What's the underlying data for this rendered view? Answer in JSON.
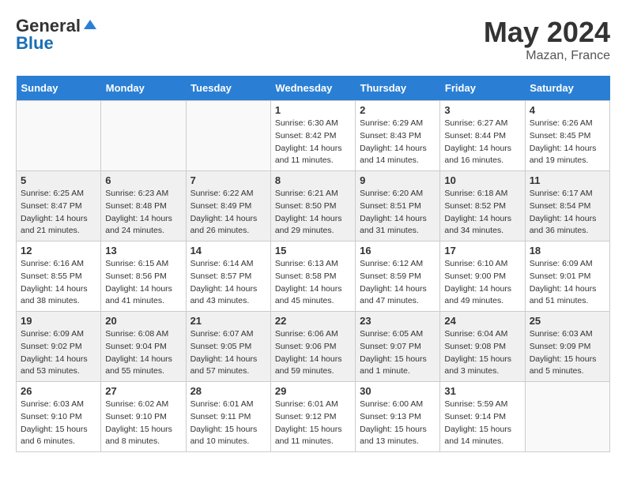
{
  "header": {
    "logo_general": "General",
    "logo_blue": "Blue",
    "title": "May 2024",
    "subtitle": "Mazan, France"
  },
  "days_of_week": [
    "Sunday",
    "Monday",
    "Tuesday",
    "Wednesday",
    "Thursday",
    "Friday",
    "Saturday"
  ],
  "weeks": [
    {
      "days": [
        {
          "number": "",
          "sunrise": "",
          "sunset": "",
          "daylight": ""
        },
        {
          "number": "",
          "sunrise": "",
          "sunset": "",
          "daylight": ""
        },
        {
          "number": "",
          "sunrise": "",
          "sunset": "",
          "daylight": ""
        },
        {
          "number": "1",
          "sunrise": "Sunrise: 6:30 AM",
          "sunset": "Sunset: 8:42 PM",
          "daylight": "Daylight: 14 hours and 11 minutes."
        },
        {
          "number": "2",
          "sunrise": "Sunrise: 6:29 AM",
          "sunset": "Sunset: 8:43 PM",
          "daylight": "Daylight: 14 hours and 14 minutes."
        },
        {
          "number": "3",
          "sunrise": "Sunrise: 6:27 AM",
          "sunset": "Sunset: 8:44 PM",
          "daylight": "Daylight: 14 hours and 16 minutes."
        },
        {
          "number": "4",
          "sunrise": "Sunrise: 6:26 AM",
          "sunset": "Sunset: 8:45 PM",
          "daylight": "Daylight: 14 hours and 19 minutes."
        }
      ]
    },
    {
      "days": [
        {
          "number": "5",
          "sunrise": "Sunrise: 6:25 AM",
          "sunset": "Sunset: 8:47 PM",
          "daylight": "Daylight: 14 hours and 21 minutes."
        },
        {
          "number": "6",
          "sunrise": "Sunrise: 6:23 AM",
          "sunset": "Sunset: 8:48 PM",
          "daylight": "Daylight: 14 hours and 24 minutes."
        },
        {
          "number": "7",
          "sunrise": "Sunrise: 6:22 AM",
          "sunset": "Sunset: 8:49 PM",
          "daylight": "Daylight: 14 hours and 26 minutes."
        },
        {
          "number": "8",
          "sunrise": "Sunrise: 6:21 AM",
          "sunset": "Sunset: 8:50 PM",
          "daylight": "Daylight: 14 hours and 29 minutes."
        },
        {
          "number": "9",
          "sunrise": "Sunrise: 6:20 AM",
          "sunset": "Sunset: 8:51 PM",
          "daylight": "Daylight: 14 hours and 31 minutes."
        },
        {
          "number": "10",
          "sunrise": "Sunrise: 6:18 AM",
          "sunset": "Sunset: 8:52 PM",
          "daylight": "Daylight: 14 hours and 34 minutes."
        },
        {
          "number": "11",
          "sunrise": "Sunrise: 6:17 AM",
          "sunset": "Sunset: 8:54 PM",
          "daylight": "Daylight: 14 hours and 36 minutes."
        }
      ]
    },
    {
      "days": [
        {
          "number": "12",
          "sunrise": "Sunrise: 6:16 AM",
          "sunset": "Sunset: 8:55 PM",
          "daylight": "Daylight: 14 hours and 38 minutes."
        },
        {
          "number": "13",
          "sunrise": "Sunrise: 6:15 AM",
          "sunset": "Sunset: 8:56 PM",
          "daylight": "Daylight: 14 hours and 41 minutes."
        },
        {
          "number": "14",
          "sunrise": "Sunrise: 6:14 AM",
          "sunset": "Sunset: 8:57 PM",
          "daylight": "Daylight: 14 hours and 43 minutes."
        },
        {
          "number": "15",
          "sunrise": "Sunrise: 6:13 AM",
          "sunset": "Sunset: 8:58 PM",
          "daylight": "Daylight: 14 hours and 45 minutes."
        },
        {
          "number": "16",
          "sunrise": "Sunrise: 6:12 AM",
          "sunset": "Sunset: 8:59 PM",
          "daylight": "Daylight: 14 hours and 47 minutes."
        },
        {
          "number": "17",
          "sunrise": "Sunrise: 6:10 AM",
          "sunset": "Sunset: 9:00 PM",
          "daylight": "Daylight: 14 hours and 49 minutes."
        },
        {
          "number": "18",
          "sunrise": "Sunrise: 6:09 AM",
          "sunset": "Sunset: 9:01 PM",
          "daylight": "Daylight: 14 hours and 51 minutes."
        }
      ]
    },
    {
      "days": [
        {
          "number": "19",
          "sunrise": "Sunrise: 6:09 AM",
          "sunset": "Sunset: 9:02 PM",
          "daylight": "Daylight: 14 hours and 53 minutes."
        },
        {
          "number": "20",
          "sunrise": "Sunrise: 6:08 AM",
          "sunset": "Sunset: 9:04 PM",
          "daylight": "Daylight: 14 hours and 55 minutes."
        },
        {
          "number": "21",
          "sunrise": "Sunrise: 6:07 AM",
          "sunset": "Sunset: 9:05 PM",
          "daylight": "Daylight: 14 hours and 57 minutes."
        },
        {
          "number": "22",
          "sunrise": "Sunrise: 6:06 AM",
          "sunset": "Sunset: 9:06 PM",
          "daylight": "Daylight: 14 hours and 59 minutes."
        },
        {
          "number": "23",
          "sunrise": "Sunrise: 6:05 AM",
          "sunset": "Sunset: 9:07 PM",
          "daylight": "Daylight: 15 hours and 1 minute."
        },
        {
          "number": "24",
          "sunrise": "Sunrise: 6:04 AM",
          "sunset": "Sunset: 9:08 PM",
          "daylight": "Daylight: 15 hours and 3 minutes."
        },
        {
          "number": "25",
          "sunrise": "Sunrise: 6:03 AM",
          "sunset": "Sunset: 9:09 PM",
          "daylight": "Daylight: 15 hours and 5 minutes."
        }
      ]
    },
    {
      "days": [
        {
          "number": "26",
          "sunrise": "Sunrise: 6:03 AM",
          "sunset": "Sunset: 9:10 PM",
          "daylight": "Daylight: 15 hours and 6 minutes."
        },
        {
          "number": "27",
          "sunrise": "Sunrise: 6:02 AM",
          "sunset": "Sunset: 9:10 PM",
          "daylight": "Daylight: 15 hours and 8 minutes."
        },
        {
          "number": "28",
          "sunrise": "Sunrise: 6:01 AM",
          "sunset": "Sunset: 9:11 PM",
          "daylight": "Daylight: 15 hours and 10 minutes."
        },
        {
          "number": "29",
          "sunrise": "Sunrise: 6:01 AM",
          "sunset": "Sunset: 9:12 PM",
          "daylight": "Daylight: 15 hours and 11 minutes."
        },
        {
          "number": "30",
          "sunrise": "Sunrise: 6:00 AM",
          "sunset": "Sunset: 9:13 PM",
          "daylight": "Daylight: 15 hours and 13 minutes."
        },
        {
          "number": "31",
          "sunrise": "Sunrise: 5:59 AM",
          "sunset": "Sunset: 9:14 PM",
          "daylight": "Daylight: 15 hours and 14 minutes."
        },
        {
          "number": "",
          "sunrise": "",
          "sunset": "",
          "daylight": ""
        }
      ]
    }
  ]
}
